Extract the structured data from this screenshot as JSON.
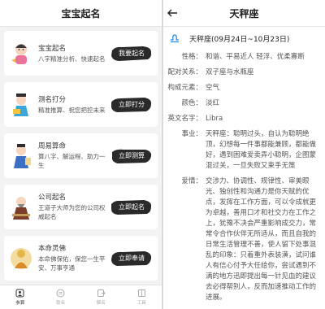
{
  "left": {
    "title": "宝宝起名",
    "cards": [
      {
        "title": "宝宝起名",
        "desc": "八字精准分析、快速起名",
        "button": "我要起名"
      },
      {
        "title": "测名打分",
        "desc": "精准推算、祝您把控未来",
        "button": "立即打分"
      },
      {
        "title": "周易算命",
        "desc": "算八字、解运程、助力一生",
        "button": "立即测算"
      },
      {
        "title": "公司起名",
        "desc": "王道子大师为您的公司权威起名",
        "button": "立即起名"
      },
      {
        "title": "本命灵佛",
        "desc": "本命佛保佑，保您一生平安、万事亨通",
        "button": "立即奉请"
      }
    ],
    "tabs": [
      {
        "label": "参算",
        "icon": "person-icon",
        "active": true
      },
      {
        "label": "取名",
        "icon": "chat-icon",
        "active": false
      },
      {
        "label": "解名",
        "icon": "exit-icon",
        "active": false
      },
      {
        "label": "工具",
        "icon": "grid-icon",
        "active": false
      }
    ]
  },
  "right": {
    "title": "天秤座",
    "sign_line": "天秤座(09月24日~10月23日)",
    "rows": [
      {
        "key": "性格：",
        "value": "和谐、平易近人 轻浮、优柔寡断"
      },
      {
        "key": "配对关系：",
        "value": "双子座与水瓶座"
      },
      {
        "key": "构成元素：",
        "value": "空气"
      },
      {
        "key": "颜色：",
        "value": "淡红"
      },
      {
        "key": "英文名字：",
        "value": "Libra"
      },
      {
        "key": "事业：",
        "value": "天秤座：聪明过头，自认为聪明绝顶，幻想每一件事都能兼顾，都能做好，遇到困难爱卖弄小聪明，企图蒙混过关，一旦失败又束手无策"
      },
      {
        "key": "爱情：",
        "value": "交涉力、协调性、规律性、审美眼光、独创性和沟通力是你天赋的优点，发挥在工作方面，可以令成就更为卓越，善用口才和社交力在工作之上，犹豫不决会严重影响成交力，常常令合作伙伴无所适从，而且自我的日常生活管理不善，使人留下处事混乱的印象：只着重外表装潢，试问谁人有信心付予大任给你，尝试遇到不满的地方迅即提出每一针见血的建议去必得帮别人，反而加速推动工作的进展。"
      }
    ]
  },
  "colors": {
    "accent": "#1e88e5",
    "ink": "#2a2a2a",
    "text_gray": "#555555"
  }
}
